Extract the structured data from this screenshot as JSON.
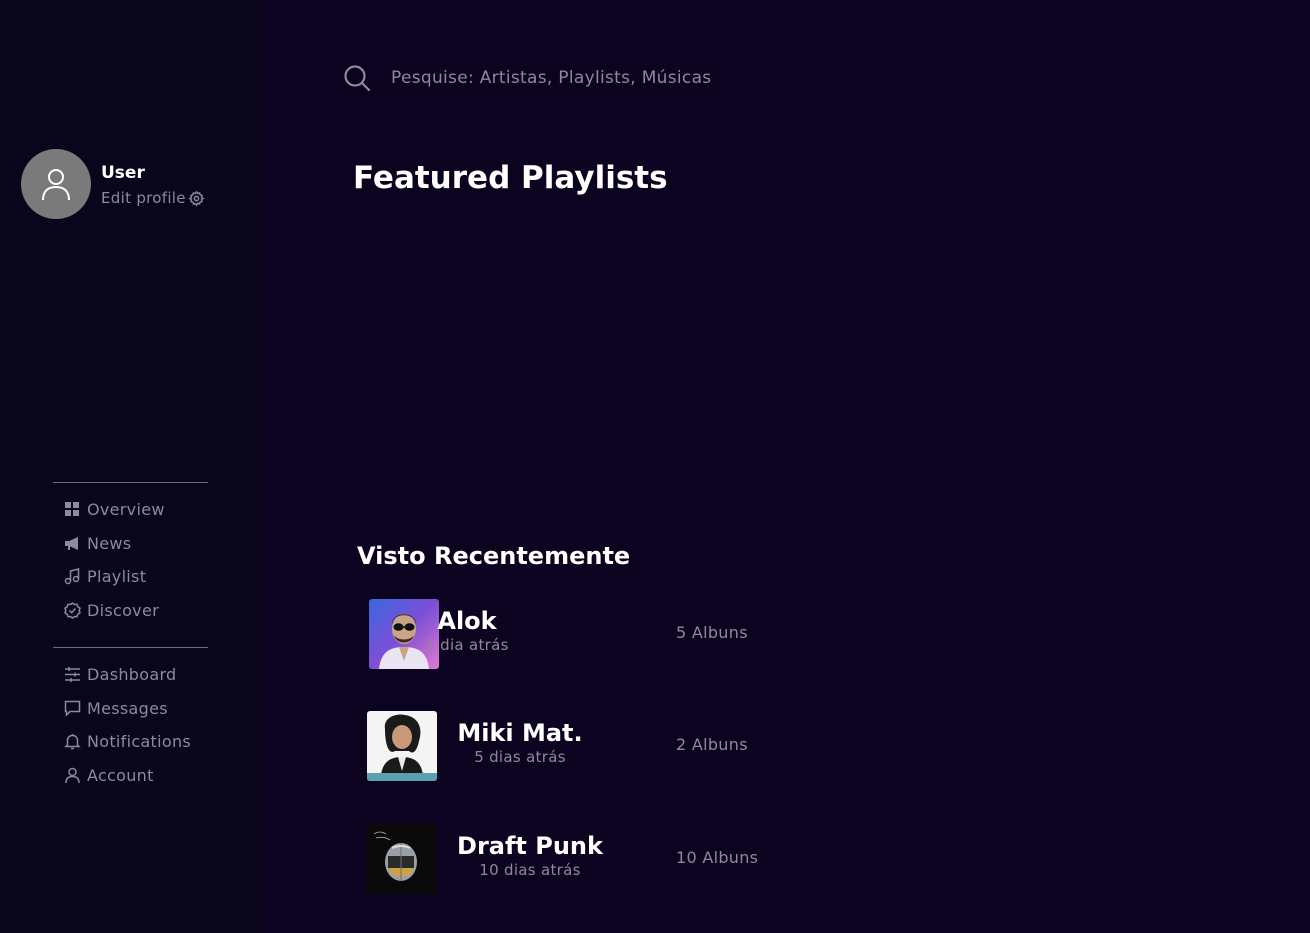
{
  "user": {
    "name": "User",
    "edit_profile": "Edit profile"
  },
  "nav": {
    "group1": [
      {
        "label": "Overview",
        "icon": "grid-icon"
      },
      {
        "label": "News",
        "icon": "megaphone-icon"
      },
      {
        "label": "Playlist",
        "icon": "music-note-icon"
      },
      {
        "label": "Discover",
        "icon": "compass-check-icon"
      }
    ],
    "group2": [
      {
        "label": "Dashboard",
        "icon": "sliders-icon"
      },
      {
        "label": "Messages",
        "icon": "chat-icon"
      },
      {
        "label": "Notifications",
        "icon": "bell-icon"
      },
      {
        "label": "Account",
        "icon": "person-icon"
      }
    ]
  },
  "search": {
    "placeholder": "Pesquise: Artistas, Playlists, Músicas"
  },
  "featured": {
    "title": "Featured Playlists"
  },
  "recent": {
    "title": "Visto Recentemente",
    "items": [
      {
        "name": "Alok",
        "time": "1 dia atrás",
        "albums": "5 Albuns"
      },
      {
        "name": "Miki Mat.",
        "time": "5 dias atrás",
        "albums": "2 Albuns"
      },
      {
        "name": "Draft Punk",
        "time": "10 dias atrás",
        "albums": "10 Albuns"
      }
    ]
  },
  "colors": {
    "background": "#0b0320",
    "sidebar": "#09051a",
    "muted_text": "#8e8a9c",
    "avatar": "#7a7a7a"
  }
}
